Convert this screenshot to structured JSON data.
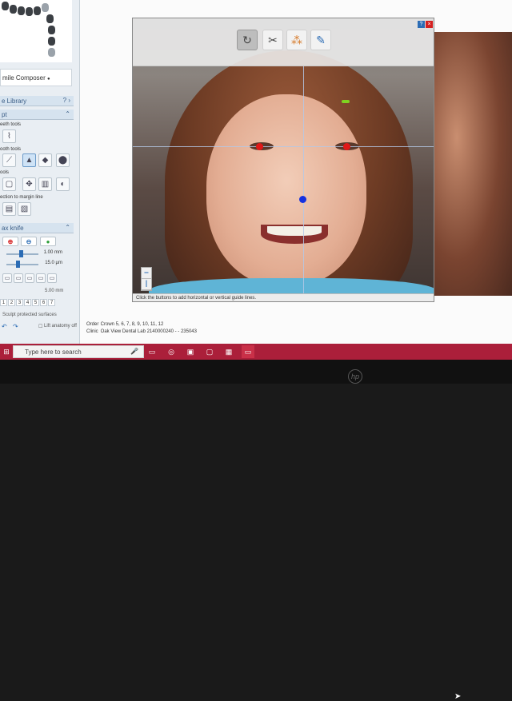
{
  "left_panel": {
    "app_name": "mile Composer",
    "library_title": "e Library",
    "library_ctl": "? ›",
    "sections": {
      "opt_header": "pt",
      "teeth_tools_label": "eeth tools",
      "tooth_tools_label": "ooth tools",
      "tools_label": "ools",
      "margin_label": "ection to margin line",
      "wax_header": "ax knife"
    },
    "wax": {
      "size_value": "1.00 mm",
      "step_value": "15.0 µm",
      "gray_value": "5.00 mm"
    },
    "numbers": [
      "1",
      "2",
      "3",
      "4",
      "5",
      "6",
      "7"
    ],
    "sculpt_label": "Sculpt protected surfaces",
    "anatomy_label": "Lift anatomy off"
  },
  "photo_window": {
    "toolbar_buttons": [
      {
        "name": "refresh-button",
        "icon": "↻"
      },
      {
        "name": "dna-button",
        "icon": "✂"
      },
      {
        "name": "points-button",
        "icon": "⁂"
      },
      {
        "name": "brush-button",
        "icon": "✎"
      }
    ],
    "status": "Click the buttons to add horizontal or vertical guide lines."
  },
  "footer_info": {
    "order_label": "Order",
    "order_value": "Crown 5, 6, 7, 8, 9, 10, 11, 12",
    "clinic_label": "Clinic",
    "clinic_value": "Oak View Dental Lab 2140000240 - - 235043"
  },
  "taskbar": {
    "search_placeholder": "Type here to search"
  },
  "colors": {
    "taskbar": "#ab1f3a",
    "accent": "#2b6cb5",
    "marker_red": "#e01818",
    "marker_blue": "#1530e0",
    "marker_green": "#7fd321"
  }
}
